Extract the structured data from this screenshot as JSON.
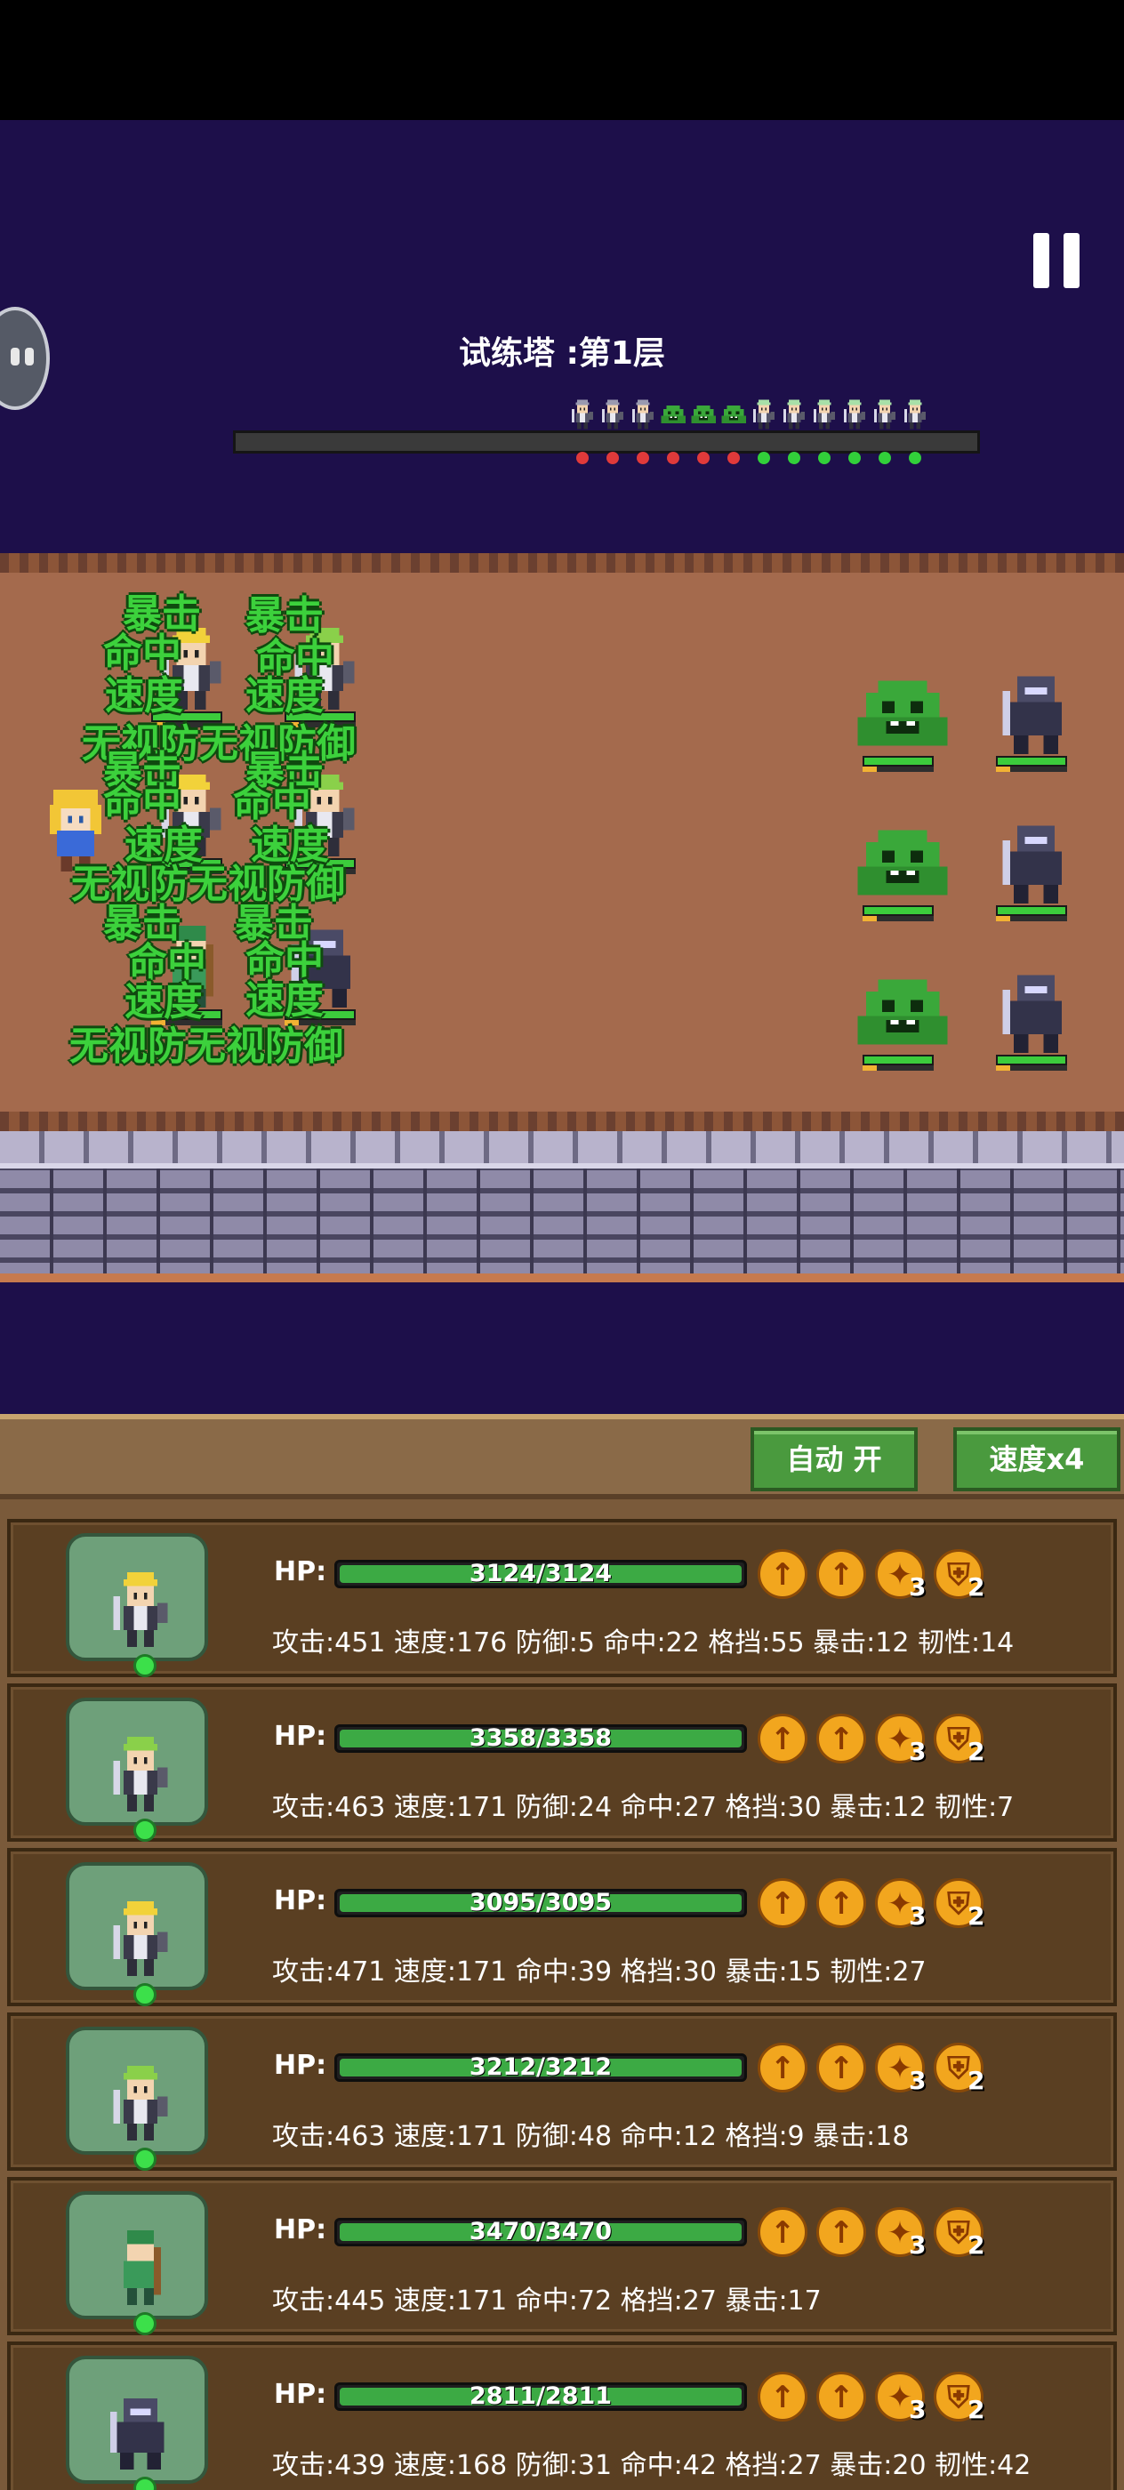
{
  "stage": {
    "title": "试练塔 :第1层"
  },
  "controls": {
    "auto_label": "自动 开",
    "speed_label": "速度x4"
  },
  "progress": {
    "enemy_markers": [
      "#e03a3a",
      "#e03a3a",
      "#e03a3a",
      "#e03a3a",
      "#e03a3a",
      "#e03a3a"
    ],
    "ally_markers": [
      "#32d03a",
      "#32d03a",
      "#32d03a",
      "#32d03a",
      "#32d03a",
      "#32d03a"
    ]
  },
  "colors": {
    "accent_green": "#3cd13c",
    "panel_brown": "#5a3f22",
    "button_green": "#4a9a3e"
  },
  "battle": {
    "hero_leader": {
      "icon": "blonde-hero-sprite"
    },
    "combat_texts": [
      "暴击",
      "暴击",
      "命中",
      "命中",
      "速度",
      "速度",
      "无视防无视防御",
      "暴击",
      "暴击",
      "命中",
      "命中",
      "速度",
      "速度",
      "无视防无视防御",
      "暴击",
      "暴击",
      "命中",
      "命中",
      "速度",
      "速度",
      "无视防无视防御"
    ],
    "enemies": [
      {
        "type": "green-slime",
        "hp": 1.0
      },
      {
        "type": "shadow-knight",
        "hp": 1.0
      },
      {
        "type": "green-slime",
        "hp": 1.0
      },
      {
        "type": "shadow-knight",
        "hp": 1.0
      },
      {
        "type": "green-slime",
        "hp": 1.0
      },
      {
        "type": "shadow-knight",
        "hp": 1.0
      }
    ]
  },
  "heroes": [
    {
      "hp_label": "HP:",
      "hp_text": "3124/3124",
      "hp_fraction": 1.0,
      "stats": "攻击:451 速度:176 防御:5 命中:22 格挡:55 暴击:12 韧性:14",
      "sprite": "blonde-knight",
      "skill_counts": [
        "3",
        "2"
      ]
    },
    {
      "hp_label": "HP:",
      "hp_text": "3358/3358",
      "hp_fraction": 1.0,
      "stats": "攻击:463 速度:171 防御:24 命中:27 格挡:30 暴击:12 韧性:7",
      "sprite": "green-knight",
      "skill_counts": [
        "3",
        "2"
      ]
    },
    {
      "hp_label": "HP:",
      "hp_text": "3095/3095",
      "hp_fraction": 1.0,
      "stats": "攻击:471 速度:171 命中:39 格挡:30 暴击:15 韧性:27",
      "sprite": "blonde-knight",
      "skill_counts": [
        "3",
        "2"
      ]
    },
    {
      "hp_label": "HP:",
      "hp_text": "3212/3212",
      "hp_fraction": 1.0,
      "stats": "攻击:463 速度:171 防御:48 命中:12 格挡:9 暴击:18",
      "sprite": "green-knight",
      "skill_counts": [
        "3",
        "2"
      ]
    },
    {
      "hp_label": "HP:",
      "hp_text": "3470/3470",
      "hp_fraction": 1.0,
      "stats": "攻击:445 速度:171 命中:72 格挡:27 暴击:17",
      "sprite": "green-archer",
      "skill_counts": [
        "3",
        "2"
      ]
    },
    {
      "hp_label": "HP:",
      "hp_text": "2811/2811",
      "hp_fraction": 1.0,
      "stats": "攻击:439 速度:168 防御:31 命中:42 格挡:27 暴击:20 韧性:42",
      "sprite": "dark-knight",
      "skill_counts": [
        "3",
        "2"
      ]
    }
  ]
}
